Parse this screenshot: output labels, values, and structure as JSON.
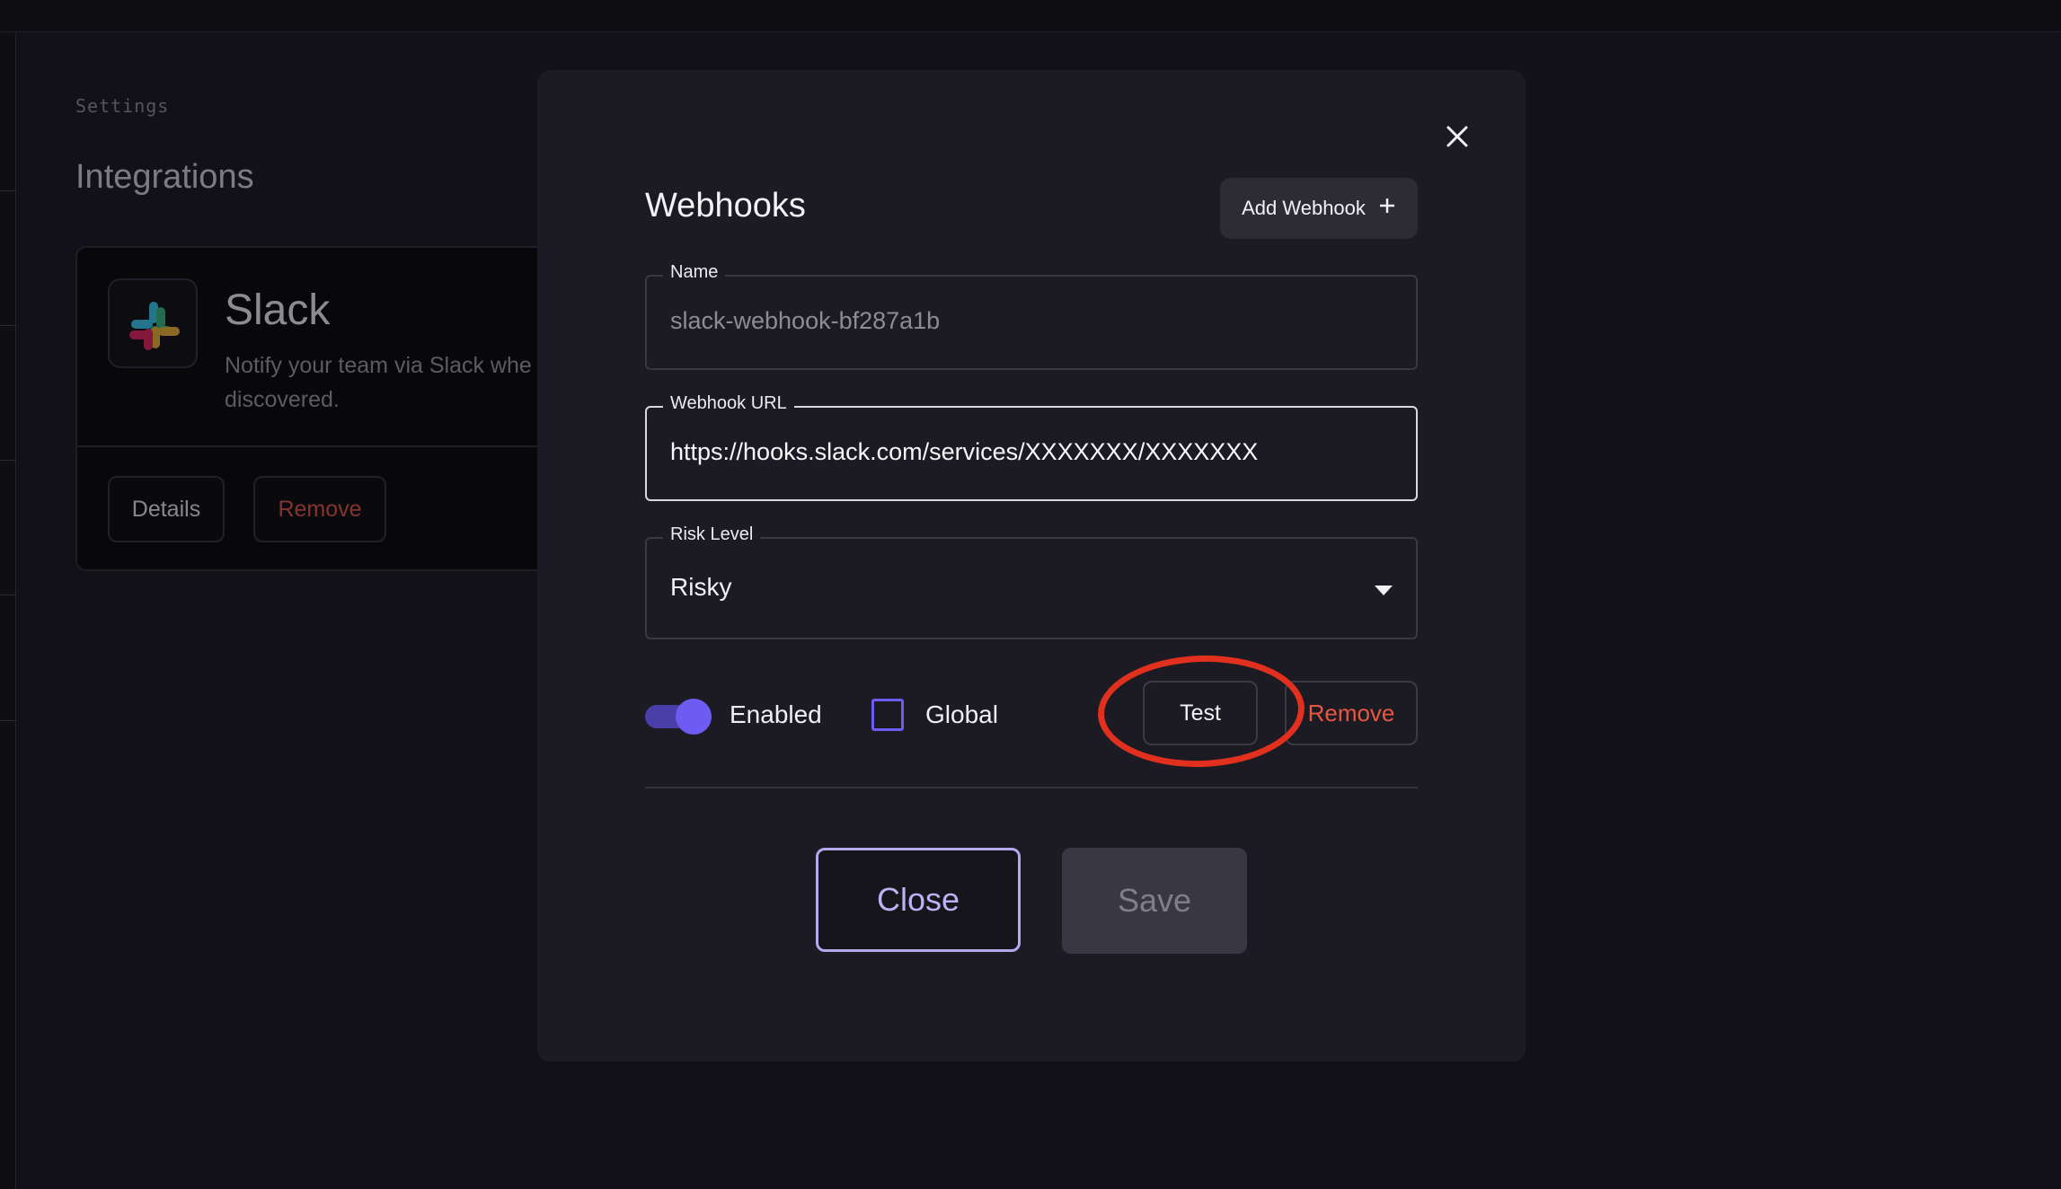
{
  "background": {
    "breadcrumb": "Settings",
    "page_title": "Integrations",
    "integration_card": {
      "title": "Slack",
      "description": "Notify your team via Slack whe discovered.",
      "details_label": "Details",
      "remove_label": "Remove",
      "logo_icon": "slack-logo"
    }
  },
  "modal": {
    "title": "Webhooks",
    "add_webhook_label": "Add Webhook",
    "add_icon": "plus-icon",
    "close_icon": "close-icon",
    "fields": {
      "name_label": "Name",
      "name_value": "slack-webhook-bf287a1b",
      "url_label": "Webhook URL",
      "url_value": "https://hooks.slack.com/services/XXXXXXX/XXXXXXX",
      "risk_label": "Risk Level",
      "risk_value": "Risky"
    },
    "options": {
      "enabled_label": "Enabled",
      "enabled": true,
      "global_label": "Global",
      "global": false
    },
    "test_label": "Test",
    "remove_label": "Remove",
    "close_label": "Close",
    "save_label": "Save"
  },
  "colors": {
    "accent": "#6c5cf2",
    "danger": "#e8573f",
    "annotation": "#e2301e",
    "modal_bg": "#1c1b23"
  }
}
